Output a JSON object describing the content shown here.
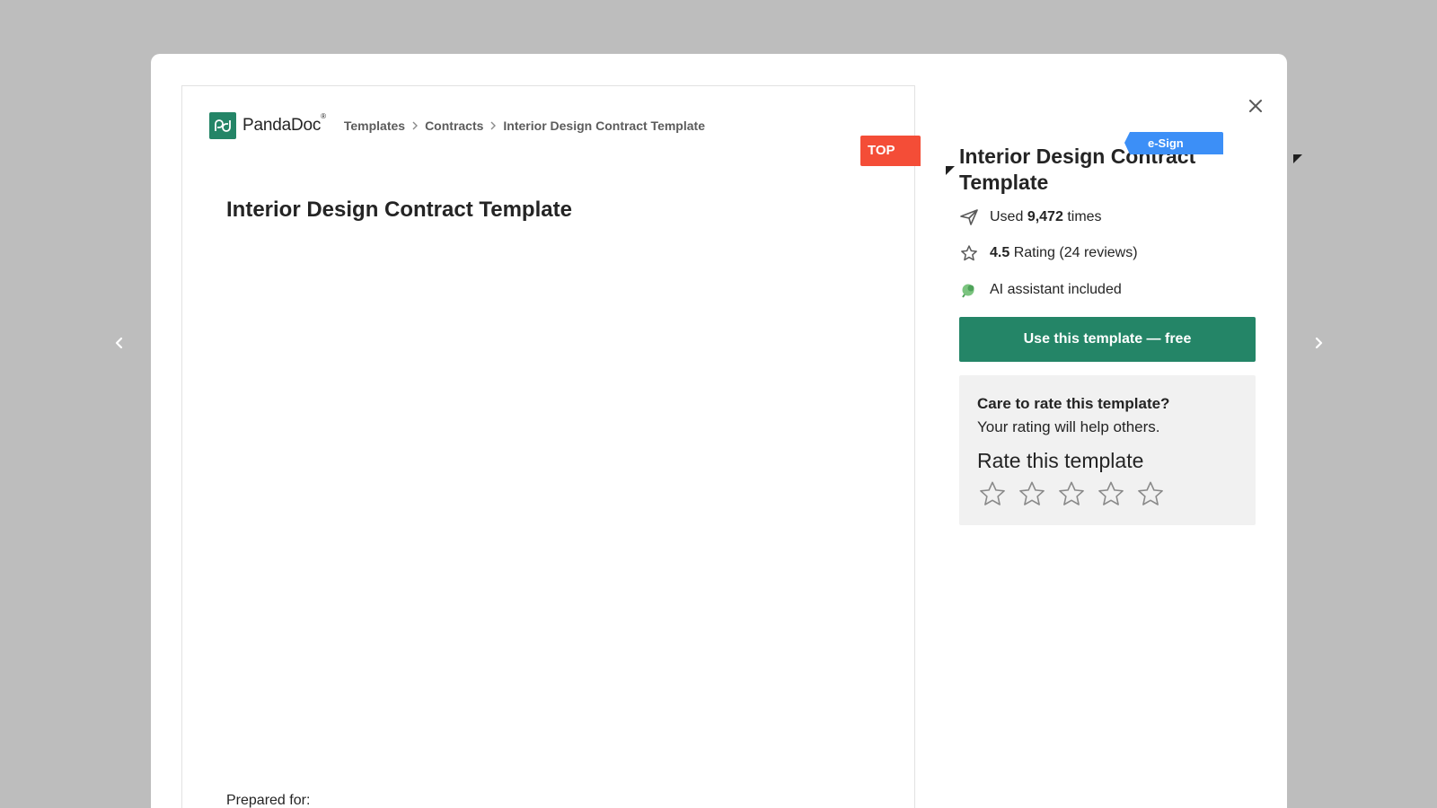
{
  "brand": {
    "name": "PandaDoc",
    "reg": "®",
    "color": "#248567"
  },
  "breadcrumb": [
    {
      "label": "Templates"
    },
    {
      "label": "Contracts"
    },
    {
      "label": "Interior Design Contract Template"
    }
  ],
  "badges": {
    "top_rated": "TOP RATED",
    "esign": "e-Sign with PandaDoc"
  },
  "document": {
    "title": "Interior Design Contract Template",
    "prepared_for": "Prepared for:"
  },
  "sidebar": {
    "title": "Interior Design Contract Template",
    "used_prefix": "Used",
    "used_count": "9,472",
    "used_suffix": "times",
    "rating_value": "4.5",
    "rating_text": "Rating (24 reviews)",
    "ai_text": "AI assistant included",
    "cta_label": "Use this template — free",
    "rate_question": "Care to rate this template?",
    "rate_subtext": "Your rating will help others.",
    "rate_heading": "Rate this template",
    "star_count": 5
  },
  "icons": {
    "prev": "chevron-left-icon",
    "next": "chevron-right-icon",
    "close": "close-icon",
    "used": "paper-plane-icon",
    "rating": "star-outline-icon",
    "ai": "ai-sparkle-icon"
  },
  "colors": {
    "overlay": "#bdbdbd",
    "top_rated": "#f44d37",
    "esign": "#3c8ff7",
    "cta": "#248567"
  }
}
